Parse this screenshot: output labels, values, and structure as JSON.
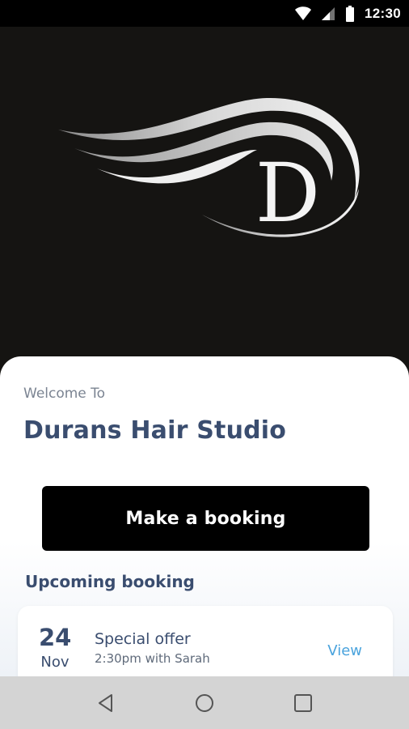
{
  "status_bar": {
    "time": "12:30",
    "icons": [
      "wifi-icon",
      "signal-icon",
      "battery-icon"
    ]
  },
  "logo": {
    "letter": "D"
  },
  "welcome": {
    "greeting": "Welcome To",
    "business_name": "Durans Hair Studio"
  },
  "actions": {
    "booking_label": "Make a booking"
  },
  "upcoming": {
    "heading": "Upcoming booking",
    "bookings": [
      {
        "day": "24",
        "month": "Nov",
        "title": "Special offer",
        "detail": "2:30pm with Sarah",
        "view_label": "View"
      }
    ]
  },
  "nav_bar": {
    "buttons": [
      "back-icon",
      "home-icon",
      "recents-icon"
    ]
  },
  "colors": {
    "hero_bg": "#151412",
    "primary_text": "#3a4d6f",
    "link": "#4aa3dd",
    "button_bg": "#000000"
  }
}
